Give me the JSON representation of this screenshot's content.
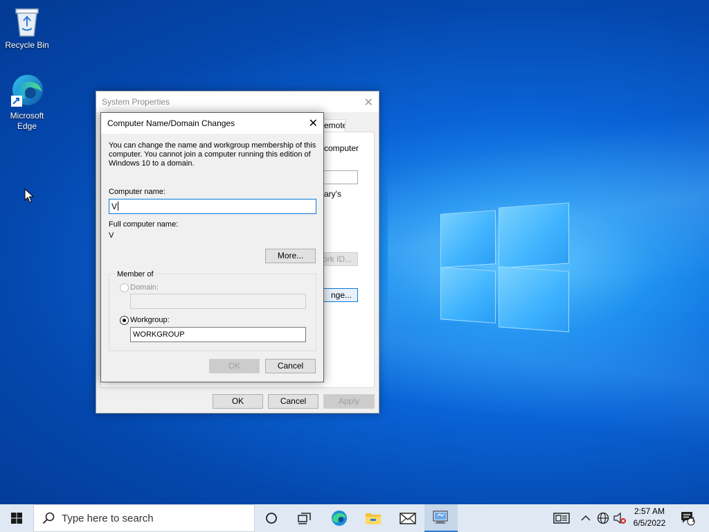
{
  "desktop": {
    "icons": [
      {
        "label": "Recycle Bin",
        "icon": "recycle-bin-icon"
      },
      {
        "label": "Microsoft Edge",
        "icon": "edge-icon"
      }
    ]
  },
  "system_properties": {
    "title": "System Properties",
    "visible_tab_fragment": "emote",
    "fragments": {
      "computer": "computer",
      "arys": "ary's",
      "network_btn": "ork ID...",
      "change_btn": "nge..."
    },
    "ok_label": "OK",
    "cancel_label": "Cancel",
    "apply_label": "Apply"
  },
  "dialog": {
    "title": "Computer Name/Domain Changes",
    "description": "You can change the name and workgroup membership of this computer. You cannot join a computer running this edition of Windows 10 to a domain.",
    "computer_name_label": "Computer name:",
    "computer_name_value": "V",
    "full_name_label": "Full computer name:",
    "full_name_value": "V",
    "more_label": "More...",
    "member_of_label": "Member of",
    "domain_label": "Domain:",
    "domain_value": "",
    "workgroup_label": "Workgroup:",
    "workgroup_value": "WORKGROUP",
    "ok_label": "OK",
    "cancel_label": "Cancel"
  },
  "taskbar": {
    "search_placeholder": "Type here to search",
    "time": "2:57 AM",
    "date": "6/5/2022",
    "notification_count": "1",
    "apps": [
      "task-view-icon",
      "edge-icon",
      "file-explorer-icon",
      "mail-icon",
      "system-properties-icon"
    ]
  },
  "colors": {
    "accent": "#0a78d7",
    "taskbar_bg": "#dfe8f3",
    "desktop_blue": "#0a63d6"
  }
}
